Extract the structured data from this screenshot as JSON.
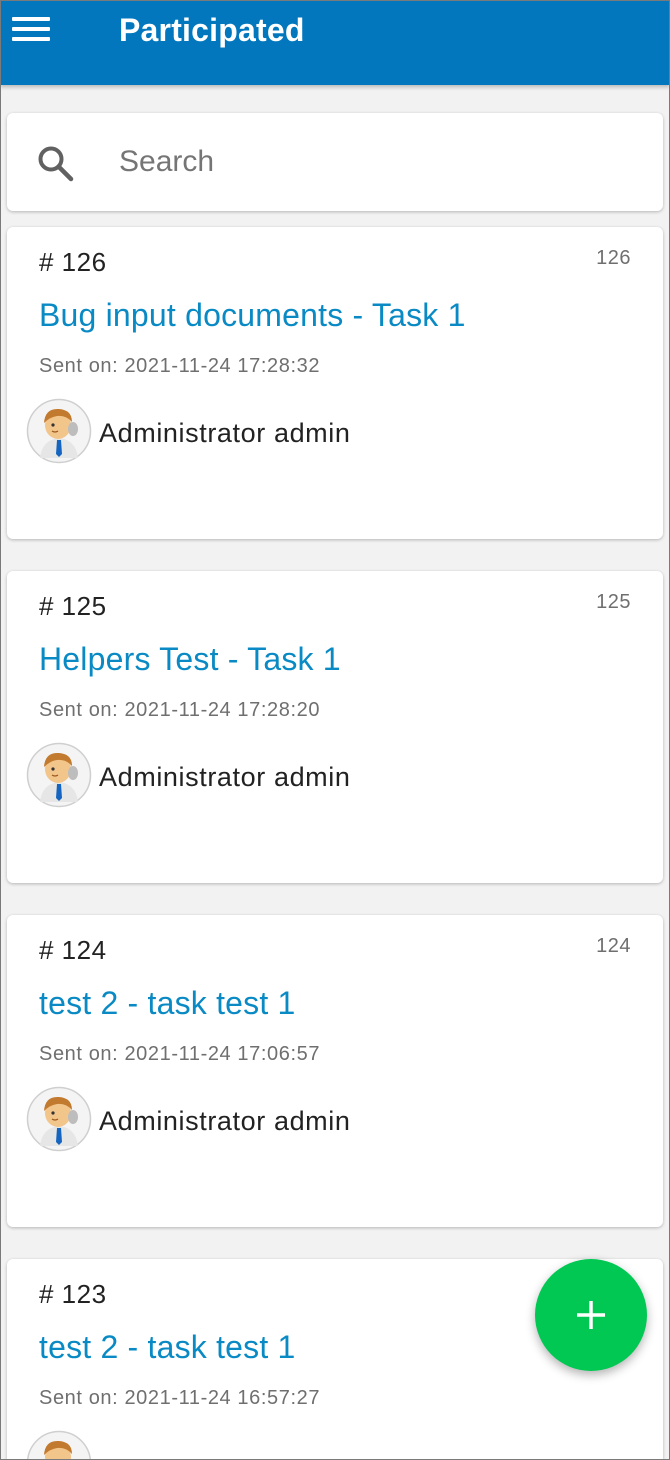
{
  "header": {
    "title": "Participated",
    "menu_icon": "hamburger-menu-icon",
    "color": "#0277bd"
  },
  "search": {
    "placeholder": "Search",
    "value": "",
    "icon": "search-icon"
  },
  "tasks": [
    {
      "number": "# 126",
      "id": "126",
      "title": "Bug input documents - Task 1",
      "sent": "Sent on: 2021-11-24 17:28:32",
      "user": "Administrator admin"
    },
    {
      "number": "# 125",
      "id": "125",
      "title": "Helpers Test - Task 1",
      "sent": "Sent on: 2021-11-24 17:28:20",
      "user": "Administrator admin"
    },
    {
      "number": "# 124",
      "id": "124",
      "title": "test 2 - task test 1",
      "sent": "Sent on: 2021-11-24 17:06:57",
      "user": "Administrator admin"
    },
    {
      "number": "# 123",
      "id": "",
      "title": "test 2 - task test 1",
      "sent": "Sent on: 2021-11-24 16:57:27",
      "user": ""
    }
  ],
  "fab": {
    "icon": "plus-icon",
    "color": "#00c853"
  },
  "colors": {
    "accent": "#0a8ac4",
    "background": "#f2f2f2"
  }
}
